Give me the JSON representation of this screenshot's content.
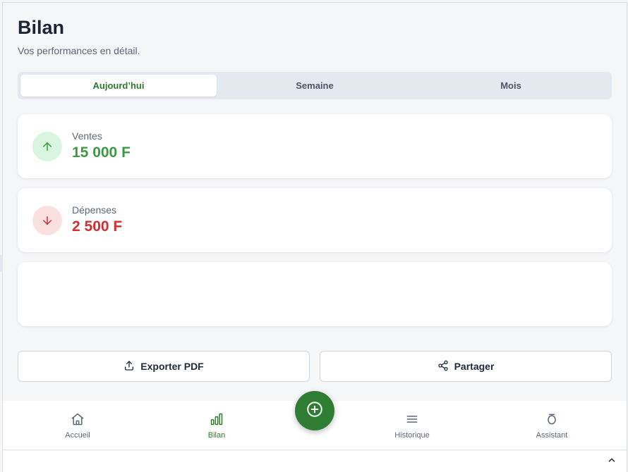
{
  "header": {
    "title": "Bilan",
    "subtitle": "Vos performances en détail."
  },
  "period_tabs": [
    {
      "label": "Aujourd’hui",
      "active": true
    },
    {
      "label": "Semaine",
      "active": false
    },
    {
      "label": "Mois",
      "active": false
    }
  ],
  "stats": {
    "sales": {
      "label": "Ventes",
      "value": "15 000 F",
      "icon": "arrow-up-icon",
      "color": "#3a9a3f",
      "icon_bg": "#d9f5df"
    },
    "expenses": {
      "label": "Dépenses",
      "value": "2 500 F",
      "icon": "arrow-down-icon",
      "color": "#d32f2f",
      "icon_bg": "#fbe0e0"
    }
  },
  "actions": {
    "export_label": "Exporter PDF",
    "share_label": "Partager"
  },
  "bottom_nav": {
    "items": [
      {
        "label": "Accueil",
        "icon": "home-icon",
        "active": false
      },
      {
        "label": "Bilan",
        "icon": "bar-chart-icon",
        "active": true
      },
      {
        "label": "Historique",
        "icon": "list-icon",
        "active": false
      },
      {
        "label": "Assistant",
        "icon": "assistant-icon",
        "active": false
      }
    ],
    "fab_icon": "plus-circle-icon"
  },
  "colors": {
    "accent": "#2e7d32",
    "positive": "#3a9a3f",
    "negative": "#d32f2f"
  }
}
